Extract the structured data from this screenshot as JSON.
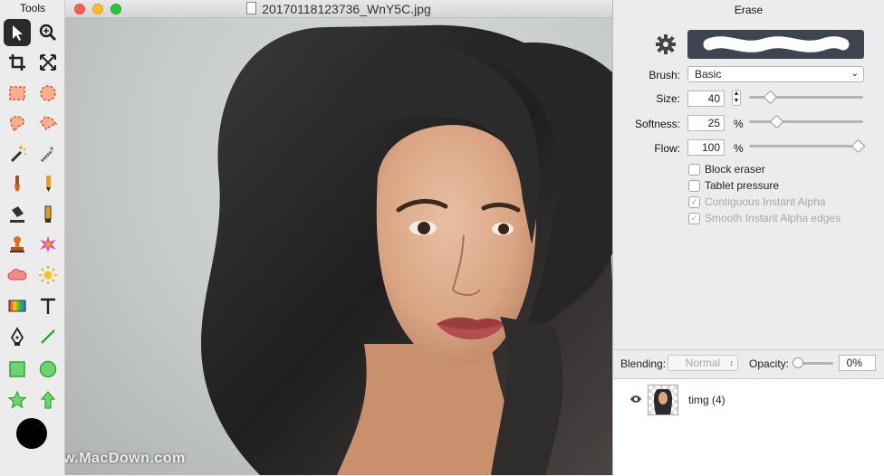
{
  "tools_panel": {
    "title": "Tools",
    "tools": [
      "pointer-icon",
      "zoom-icon",
      "crop-icon",
      "flip-icon",
      "rect-select-icon",
      "ellipse-select-icon",
      "lasso-icon",
      "polygon-lasso-icon",
      "magic-wand-icon",
      "quick-select-icon",
      "brush-icon",
      "pencil-icon",
      "paint-bucket-icon",
      "gradient-fill-icon",
      "clone-stamp-icon",
      "color-splash-icon",
      "cloud-shape-icon",
      "sun-icon",
      "gradient-icon",
      "text-icon",
      "pen-icon",
      "line-icon",
      "rectangle-icon",
      "circle-icon",
      "star-icon",
      "arrow-icon"
    ],
    "active_tool": "pointer-icon",
    "foreground_color": "#000000"
  },
  "document": {
    "filename": "20170118123736_WnY5C.jpg",
    "watermark": "www.MacDown.com"
  },
  "inspector": {
    "title": "Erase",
    "brush_label": "Brush:",
    "brush_value": "Basic",
    "size_label": "Size:",
    "size_value": "40",
    "size_level": 0.19,
    "softness_label": "Softness:",
    "softness_value": "25",
    "softness_unit": "%",
    "softness_level": 0.25,
    "flow_label": "Flow:",
    "flow_value": "100",
    "flow_unit": "%",
    "flow_level": 1.0,
    "options": [
      {
        "label": "Block eraser",
        "checked": false,
        "enabled": true
      },
      {
        "label": "Tablet pressure",
        "checked": false,
        "enabled": true
      },
      {
        "label": "Contiguous Instant Alpha",
        "checked": true,
        "enabled": false
      },
      {
        "label": "Smooth Instant Alpha edges",
        "checked": true,
        "enabled": false
      }
    ],
    "blending_label": "Blending:",
    "blending_value": "Normal",
    "opacity_label": "Opacity:",
    "opacity_value": "0%"
  },
  "layers": [
    {
      "name": "timg (4)",
      "visible": true
    }
  ],
  "colors": {
    "traffic_close": "#fc5f57",
    "traffic_min": "#fdbc2e",
    "traffic_max": "#28c840",
    "brush_preview_bg": "#3e4550"
  }
}
